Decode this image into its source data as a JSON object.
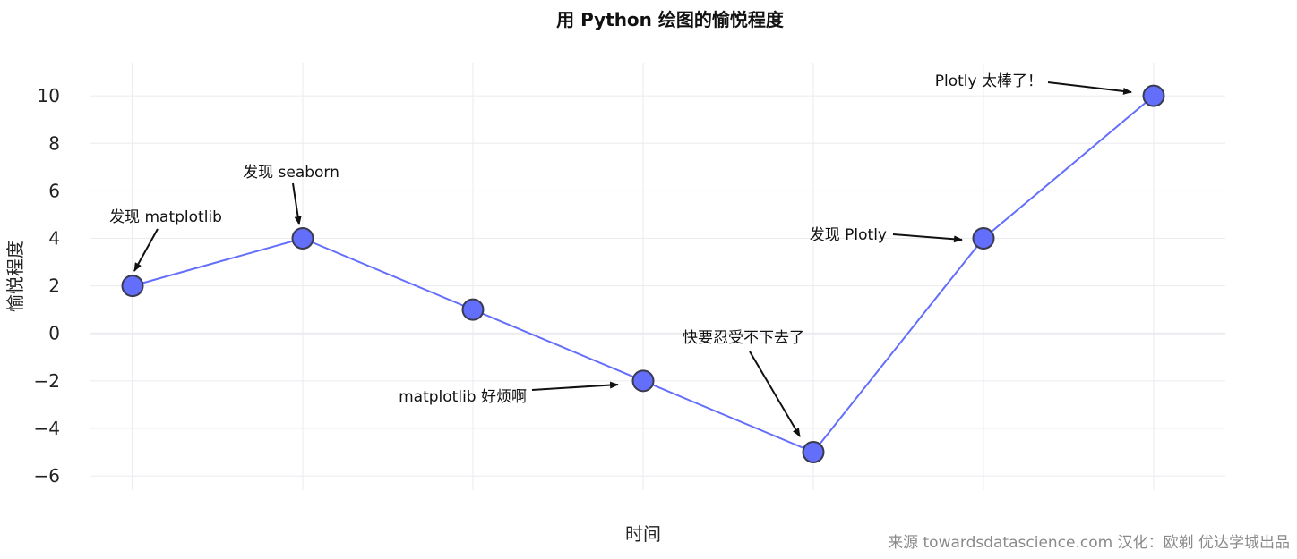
{
  "chart_data": {
    "type": "line",
    "title": "用 Python 绘图的愉悦程度",
    "xlabel": "时间",
    "ylabel": "愉悦程度",
    "x": [
      0,
      1,
      2,
      3,
      4,
      5,
      6
    ],
    "series": [
      {
        "values": [
          2,
          4,
          1,
          -2,
          -5,
          4,
          10
        ]
      }
    ],
    "ylim": [
      -6.6,
      11.4
    ],
    "yticks": [
      -6,
      -4,
      -2,
      0,
      2,
      4,
      6,
      8,
      10
    ],
    "ytick_labels": [
      "−6",
      "−4",
      "−2",
      "0",
      "2",
      "4",
      "6",
      "8",
      "10"
    ],
    "x_tick_labels_shown": false,
    "grid": true,
    "line_color": "#636efa",
    "marker_color": "#636efa",
    "marker_edge_color": "#3a3a50",
    "annotations": [
      {
        "text": "发现 matplotlib",
        "point_index": 0
      },
      {
        "text": "发现 seaborn",
        "point_index": 1
      },
      {
        "text": "matplotlib 好烦啊",
        "point_index": 3
      },
      {
        "text": "快要忍受不下去了",
        "point_index": 4
      },
      {
        "text": "发现 Plotly",
        "point_index": 5
      },
      {
        "text": "Plotly 太棒了！",
        "point_index": 6
      }
    ],
    "source_note": "来源 towardsdatascience.com 汉化：欧剃 优达学城出品"
  }
}
